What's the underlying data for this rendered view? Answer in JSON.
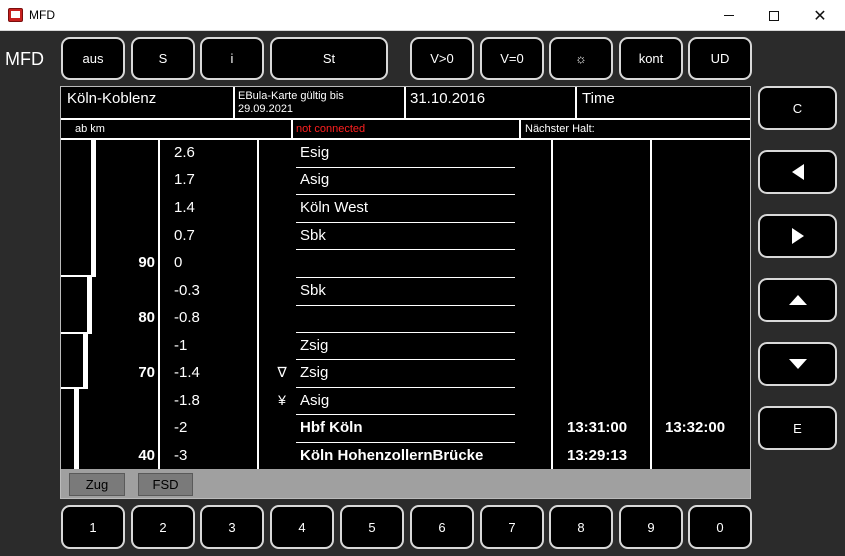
{
  "window": {
    "title": "MFD"
  },
  "app_label": "MFD",
  "top_buttons": [
    "aus",
    "S",
    "i",
    "St",
    "V>0",
    "V=0",
    "☼",
    "kont",
    "UD"
  ],
  "header": {
    "route": "Köln-Koblenz",
    "ebula_line1": "EBula-Karte gültig bis",
    "ebula_line2": "29.09.2021",
    "date": "31.10.2016",
    "time_label": "Time",
    "ab_km": "ab km",
    "connection_status": "not connected",
    "next_stop_label": "Nächster Halt:"
  },
  "speed_labels": [
    "90",
    "80",
    "70",
    "40"
  ],
  "rows": [
    {
      "km": "2.6",
      "symbol": "",
      "name": "Esig",
      "arrival": "",
      "departure": ""
    },
    {
      "km": "1.7",
      "symbol": "",
      "name": "Asig",
      "arrival": "",
      "departure": ""
    },
    {
      "km": "1.4",
      "symbol": "",
      "name": "Köln West",
      "arrival": "",
      "departure": ""
    },
    {
      "km": "0.7",
      "symbol": "",
      "name": "Sbk",
      "arrival": "",
      "departure": ""
    },
    {
      "km": "0",
      "symbol": "",
      "name": "",
      "arrival": "",
      "departure": ""
    },
    {
      "km": "-0.3",
      "symbol": "",
      "name": "Sbk",
      "arrival": "",
      "departure": ""
    },
    {
      "km": "-0.8",
      "symbol": "",
      "name": "",
      "arrival": "",
      "departure": ""
    },
    {
      "km": "-1",
      "symbol": "",
      "name": "Zsig",
      "arrival": "",
      "departure": ""
    },
    {
      "km": "-1.4",
      "symbol": "∇",
      "name": "Zsig",
      "arrival": "",
      "departure": ""
    },
    {
      "km": "-1.8",
      "symbol": "¥",
      "name": "Asig",
      "arrival": "",
      "departure": ""
    },
    {
      "km": "-2",
      "symbol": "",
      "name": "Hbf Köln",
      "arrival": "13:31:00",
      "departure": "13:32:00"
    },
    {
      "km": "-3",
      "symbol": "",
      "name": "Köln HohenzollernBrücke",
      "arrival": "13:29:13",
      "departure": ""
    }
  ],
  "bottom_tabs": [
    "Zug",
    "FSD"
  ],
  "side_buttons": [
    "C",
    "E"
  ],
  "side_icons": [
    "triangle-left-icon",
    "triangle-right-icon",
    "triangle-up-icon",
    "triangle-down-icon"
  ],
  "number_buttons": [
    "1",
    "2",
    "3",
    "4",
    "5",
    "6",
    "7",
    "8",
    "9",
    "0"
  ]
}
